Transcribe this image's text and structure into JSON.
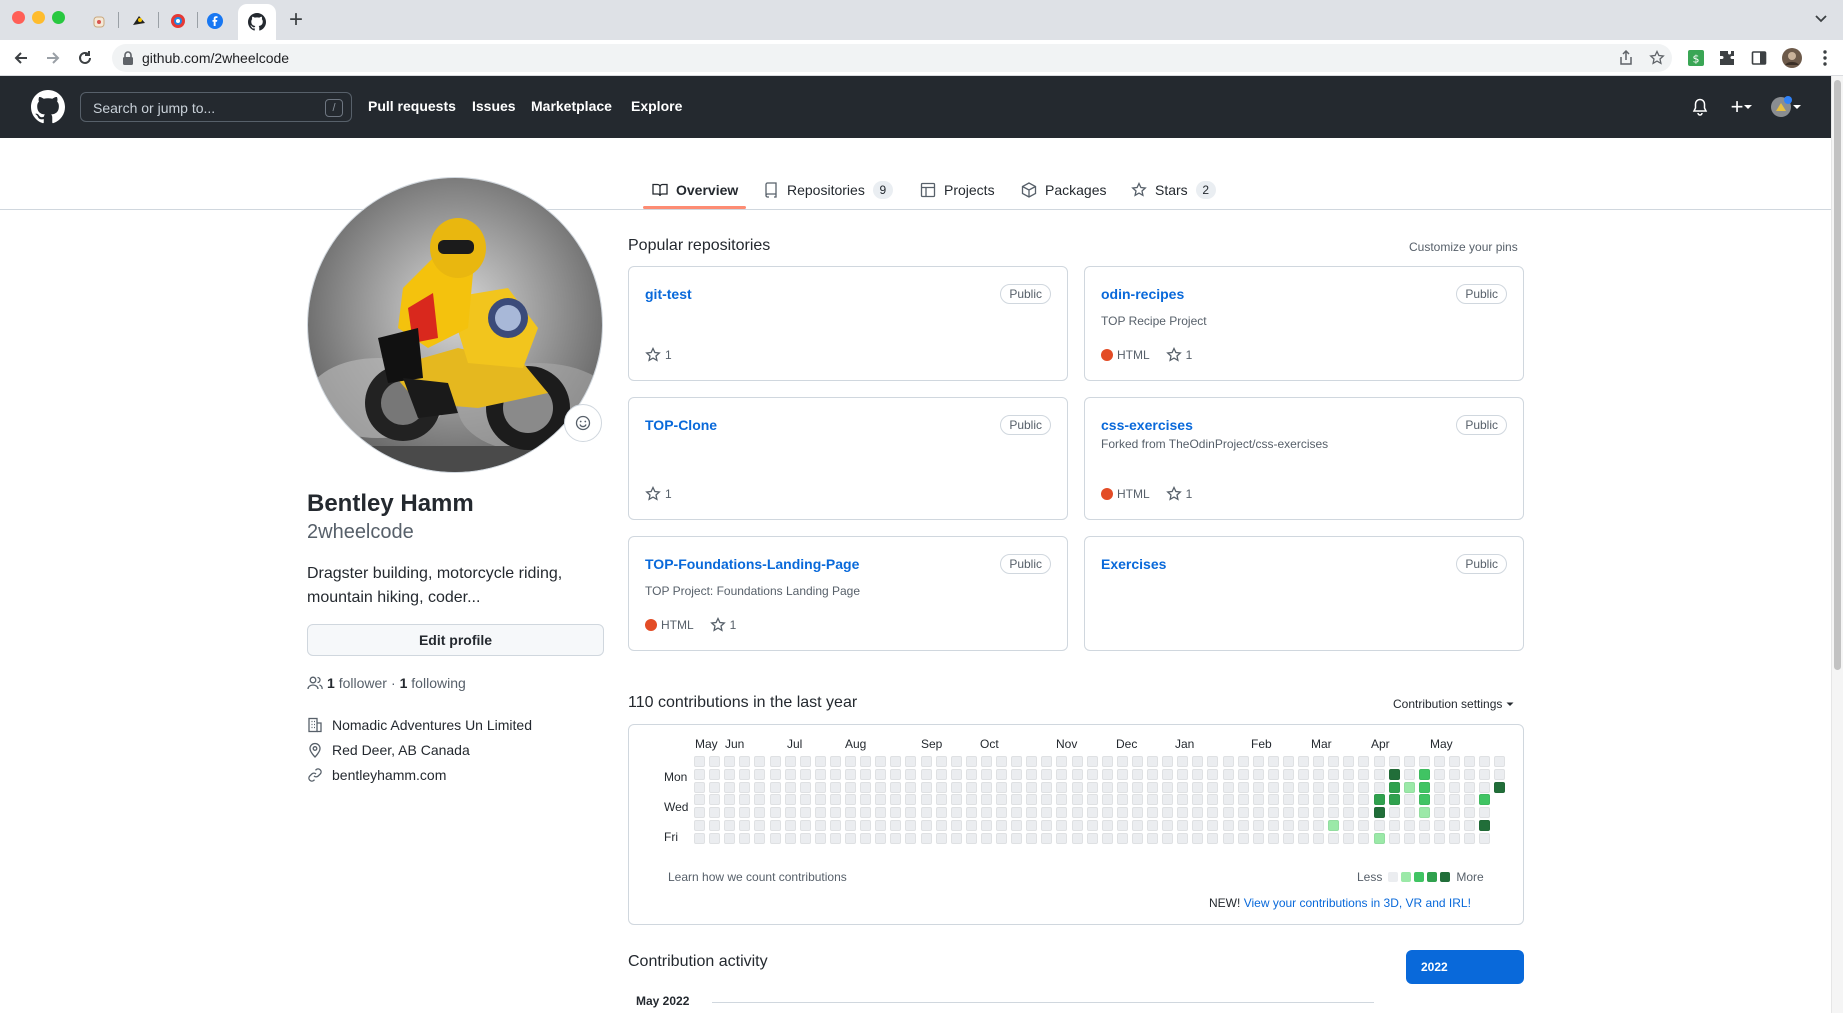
{
  "browser": {
    "url": "github.com/2wheelcode",
    "tab_favicons": [
      "kettle-favicon",
      "bird-favicon",
      "colorful-favicon",
      "facebook-favicon",
      "github-favicon"
    ],
    "new_tab": "+"
  },
  "header": {
    "search_placeholder": "Search or jump to...",
    "search_shortcut": "/",
    "nav": [
      "Pull requests",
      "Issues",
      "Marketplace",
      "Explore"
    ],
    "create_label": "+"
  },
  "tabs": [
    {
      "label": "Overview",
      "icon": "book-icon",
      "active": true
    },
    {
      "label": "Repositories",
      "icon": "repo-icon",
      "count": "9"
    },
    {
      "label": "Projects",
      "icon": "table-icon"
    },
    {
      "label": "Packages",
      "icon": "package-icon"
    },
    {
      "label": "Stars",
      "icon": "star-icon",
      "count": "2"
    }
  ],
  "profile": {
    "fullname": "Bentley Hamm",
    "username": "2wheelcode",
    "bio": "Dragster building, motorcycle riding, mountain hiking, coder...",
    "edit_label": "Edit profile",
    "followers": "1",
    "followers_label": "follower",
    "separator": "·",
    "following": "1",
    "following_label": "following",
    "company": "Nomadic Adventures Un Limited",
    "location": "Red Deer, AB Canada",
    "website": "bentleyhamm.com"
  },
  "pinned": {
    "title": "Popular repositories",
    "customize": "Customize your pins",
    "repos": [
      {
        "name": "git-test",
        "badge": "Public",
        "desc": "",
        "lang": "",
        "stars": "1"
      },
      {
        "name": "odin-recipes",
        "badge": "Public",
        "desc": "TOP Recipe Project",
        "lang": "HTML",
        "stars": "1"
      },
      {
        "name": "TOP-Clone",
        "badge": "Public",
        "desc": "",
        "lang": "",
        "stars": "1"
      },
      {
        "name": "css-exercises",
        "badge": "Public",
        "desc": "Forked from TheOdinProject/css-exercises",
        "lang": "HTML",
        "stars": "1"
      },
      {
        "name": "TOP-Foundations-Landing-Page",
        "badge": "Public",
        "desc": "TOP Project: Foundations Landing Page",
        "lang": "HTML",
        "stars": "1"
      },
      {
        "name": "Exercises",
        "badge": "Public",
        "desc": "",
        "lang": "",
        "stars": ""
      }
    ],
    "html_color": "#e34c26"
  },
  "contributions": {
    "title": "110 contributions in the last year",
    "settings": "Contribution settings",
    "months": [
      "May",
      "Jun",
      "Jul",
      "Aug",
      "Sep",
      "Oct",
      "Nov",
      "Dec",
      "Jan",
      "Feb",
      "Mar",
      "Apr",
      "May"
    ],
    "days": [
      "Mon",
      "Wed",
      "Fri"
    ],
    "learn": "Learn how we count contributions",
    "less": "Less",
    "more": "More",
    "new_prefix": "NEW!",
    "new_link": "View your contributions in 3D, VR and IRL!",
    "colors": [
      "#ebedf0",
      "#9be9a8",
      "#40c463",
      "#30a14e",
      "#216e39"
    ],
    "weeks": 53,
    "active_cells": [
      {
        "week": 42,
        "day": 5,
        "level": 1
      },
      {
        "week": 45,
        "day": 3,
        "level": 3
      },
      {
        "week": 45,
        "day": 4,
        "level": 4
      },
      {
        "week": 45,
        "day": 6,
        "level": 1
      },
      {
        "week": 46,
        "day": 1,
        "level": 4
      },
      {
        "week": 46,
        "day": 2,
        "level": 3
      },
      {
        "week": 46,
        "day": 3,
        "level": 3
      },
      {
        "week": 47,
        "day": 2,
        "level": 1
      },
      {
        "week": 48,
        "day": 1,
        "level": 2
      },
      {
        "week": 48,
        "day": 2,
        "level": 2
      },
      {
        "week": 48,
        "day": 3,
        "level": 2
      },
      {
        "week": 48,
        "day": 4,
        "level": 1
      },
      {
        "week": 52,
        "day": 3,
        "level": 2
      },
      {
        "week": 52,
        "day": 5,
        "level": 4
      },
      {
        "week": 53,
        "day": 2,
        "level": 4
      }
    ]
  },
  "activity": {
    "title": "Contribution activity",
    "year": "2022",
    "month": "May 2022"
  }
}
